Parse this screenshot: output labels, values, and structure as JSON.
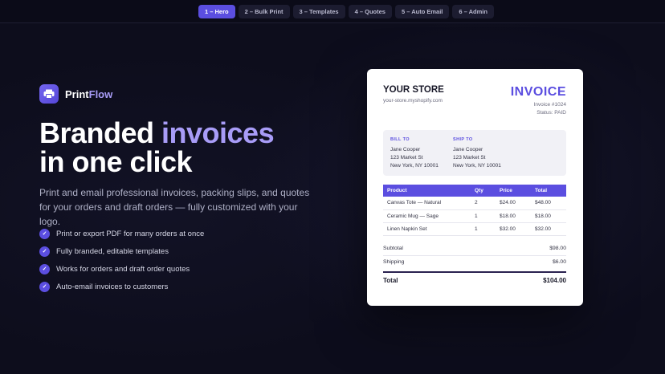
{
  "nav": {
    "tabs": [
      {
        "label": "1 – Hero",
        "active": true
      },
      {
        "label": "2 – Bulk Print",
        "active": false
      },
      {
        "label": "3 – Templates",
        "active": false
      },
      {
        "label": "4 – Quotes",
        "active": false
      },
      {
        "label": "5 – Auto Email",
        "active": false
      },
      {
        "label": "6 – Admin",
        "active": false
      }
    ]
  },
  "brand": {
    "name_prefix": "Print",
    "name_suffix": "Flow",
    "icon": "printer-icon",
    "accent_color": "#5b4ee0"
  },
  "hero": {
    "headline_plain": "Branded ",
    "headline_accent": "invoices",
    "headline_line2": "in one click",
    "subtext": "Print and email professional invoices, packing slips, and quotes for your orders and draft orders — fully customized with your logo.",
    "features": [
      "Print or export PDF for many orders at once",
      "Fully branded, editable templates",
      "Works for orders and draft order quotes",
      "Auto-email invoices to customers"
    ]
  },
  "invoice": {
    "store_name": "YOUR STORE",
    "store_url": "your-store.myshopify.com",
    "title": "INVOICE",
    "number": "Invoice #1024",
    "status": "Status: PAID",
    "bill_to": {
      "label": "BILL TO",
      "name": "Jane Cooper",
      "street": "123 Market St",
      "city": "New York, NY 10001"
    },
    "ship_to": {
      "label": "SHIP TO",
      "name": "Jane Cooper",
      "street": "123 Market St",
      "city": "New York, NY 10001"
    },
    "columns": [
      "Product",
      "Qty",
      "Price",
      "Total"
    ],
    "rows": [
      [
        "Canvas Tote — Natural",
        "2",
        "$24.00",
        "$48.00"
      ],
      [
        "Ceramic Mug — Sage",
        "1",
        "$18.00",
        "$18.00"
      ],
      [
        "Linen Napkin Set",
        "1",
        "$32.00",
        "$32.00"
      ]
    ],
    "subtotal_label": "Subtotal",
    "subtotal_value": "$98.00",
    "shipping_label": "Shipping",
    "shipping_value": "$6.00",
    "total_label": "Total",
    "total_value": "$104.00"
  }
}
